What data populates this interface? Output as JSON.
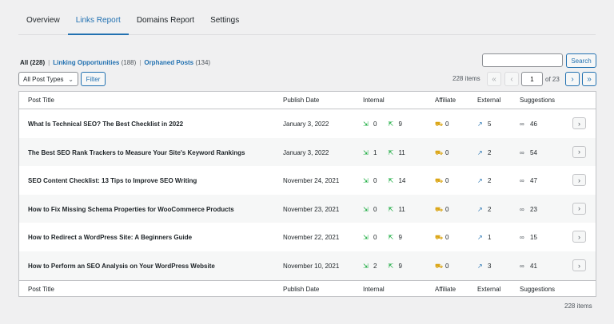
{
  "tabs": [
    "Overview",
    "Links Report",
    "Domains Report",
    "Settings"
  ],
  "filters": {
    "all": {
      "label": "All",
      "count": "(228)"
    },
    "opportunities": {
      "label": "Linking Opportunities",
      "count": "(188)"
    },
    "orphaned": {
      "label": "Orphaned Posts",
      "count": "(134)"
    },
    "separator": "|"
  },
  "search": {
    "value": "",
    "button": "Search"
  },
  "post_type": {
    "selected": "All Post Types",
    "filter_button": "Filter"
  },
  "pagination": {
    "items": "228 items",
    "first": "«",
    "prev": "‹",
    "next": "›",
    "last": "»",
    "current_page": "1",
    "of_pages": "of 23"
  },
  "columns": {
    "title": "Post Title",
    "date": "Publish Date",
    "internal": "Internal",
    "affiliate": "Affiliate",
    "external": "External",
    "suggestions": "Suggestions"
  },
  "icons": {
    "internal_in": "internal-inbound-icon",
    "internal_out": "internal-outbound-icon",
    "affiliate": "cart-icon",
    "external": "external-link-icon",
    "suggestions": "link-icon",
    "row_action": "chevron-right-icon"
  },
  "colors": {
    "accent": "#2271b1",
    "internal": "#00a32a",
    "affiliate": "#dba617"
  },
  "rows": [
    {
      "title": "What Is Technical SEO? The Best Checklist in 2022",
      "date": "January 3, 2022",
      "int_in": "0",
      "int_out": "9",
      "affiliate": "0",
      "external": "5",
      "suggestions": "46"
    },
    {
      "title": "The Best SEO Rank Trackers to Measure Your Site's Keyword Rankings",
      "date": "January 3, 2022",
      "int_in": "1",
      "int_out": "11",
      "affiliate": "0",
      "external": "2",
      "suggestions": "54"
    },
    {
      "title": "SEO Content Checklist: 13 Tips to Improve SEO Writing",
      "date": "November 24, 2021",
      "int_in": "0",
      "int_out": "14",
      "affiliate": "0",
      "external": "2",
      "suggestions": "47"
    },
    {
      "title": "How to Fix Missing Schema Properties for WooCommerce Products",
      "date": "November 23, 2021",
      "int_in": "0",
      "int_out": "11",
      "affiliate": "0",
      "external": "2",
      "suggestions": "23"
    },
    {
      "title": "How to Redirect a WordPress Site: A Beginners Guide",
      "date": "November 22, 2021",
      "int_in": "0",
      "int_out": "9",
      "affiliate": "0",
      "external": "1",
      "suggestions": "15"
    },
    {
      "title": "How to Perform an SEO Analysis on Your WordPress Website",
      "date": "November 10, 2021",
      "int_in": "2",
      "int_out": "9",
      "affiliate": "0",
      "external": "3",
      "suggestions": "41"
    }
  ]
}
